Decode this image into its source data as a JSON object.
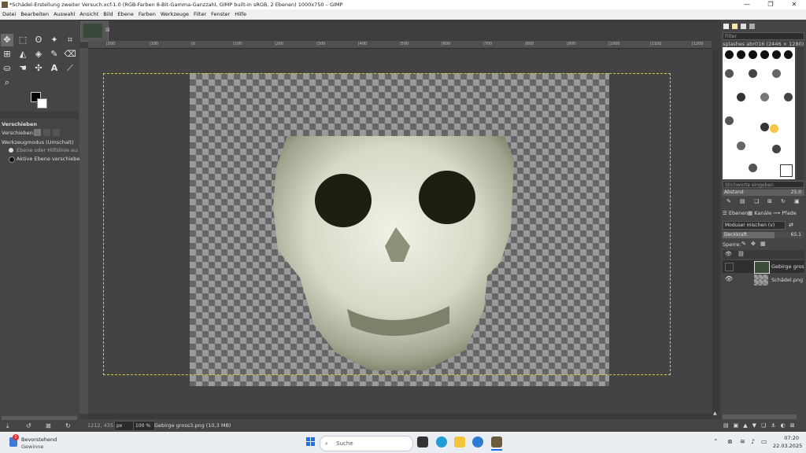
{
  "window": {
    "title": "*Schädel-Erstellung zweiter Versuch.xcf-1.0 (RGB-Farben 8-Bit-Gamma-Ganzzahl, GIMP built-in sRGB, 2 Ebenen) 1000x750 – GIMP",
    "controls": [
      "—",
      "❐",
      "✕"
    ]
  },
  "menubar": [
    "Datei",
    "Bearbeiten",
    "Auswahl",
    "Ansicht",
    "Bild",
    "Ebene",
    "Farben",
    "Werkzeuge",
    "Filter",
    "Fenster",
    "Hilfe"
  ],
  "ruler": {
    "top_ticks": [
      "|200",
      "|100",
      "|0",
      "|100",
      "|200",
      "|300",
      "|400",
      "|500",
      "|600",
      "|700",
      "|800",
      "|900",
      "|1000",
      "|1100",
      "|1200"
    ]
  },
  "tool_options": {
    "title": "Verschieben",
    "move_label": "Verschieben:",
    "mode_title": "Werkzeugmodus (Umschalt)",
    "option_1": "Ebene oder Hilfslinie auswählen",
    "option_2": "Aktive Ebene verschieben"
  },
  "status": {
    "coords": "1212, 435",
    "unit": "px",
    "zoom": "100 %",
    "info": "Gebirge gross3.png (10,3 MB)"
  },
  "brushes": {
    "filter_placeholder": "Filter",
    "title": "splashes abr016 (2446 × 1280)",
    "tag_placeholder": "Stichworte eingeben",
    "spacing_label": "Abstand",
    "spacing_value": "25.0"
  },
  "layers_panel": {
    "tabs": [
      "Ebenen",
      "Kanäle",
      "Pfade"
    ],
    "mode": "Modus",
    "mode_overlay": "er mischen (v)",
    "opacity_label": "Deckkraft",
    "opacity_value": "65.1",
    "lock_label": "Sperre:",
    "layers": [
      {
        "name": "Gebirge gross3.png",
        "visible": false
      },
      {
        "name": "Schädel.png",
        "visible": true
      }
    ]
  },
  "taskbar": {
    "weather_title": "Bevorstehend",
    "weather_sub": "Gewinne",
    "weather_badge": "1",
    "search_placeholder": "Suche",
    "time": "07:20",
    "date": "22.03.2025"
  }
}
